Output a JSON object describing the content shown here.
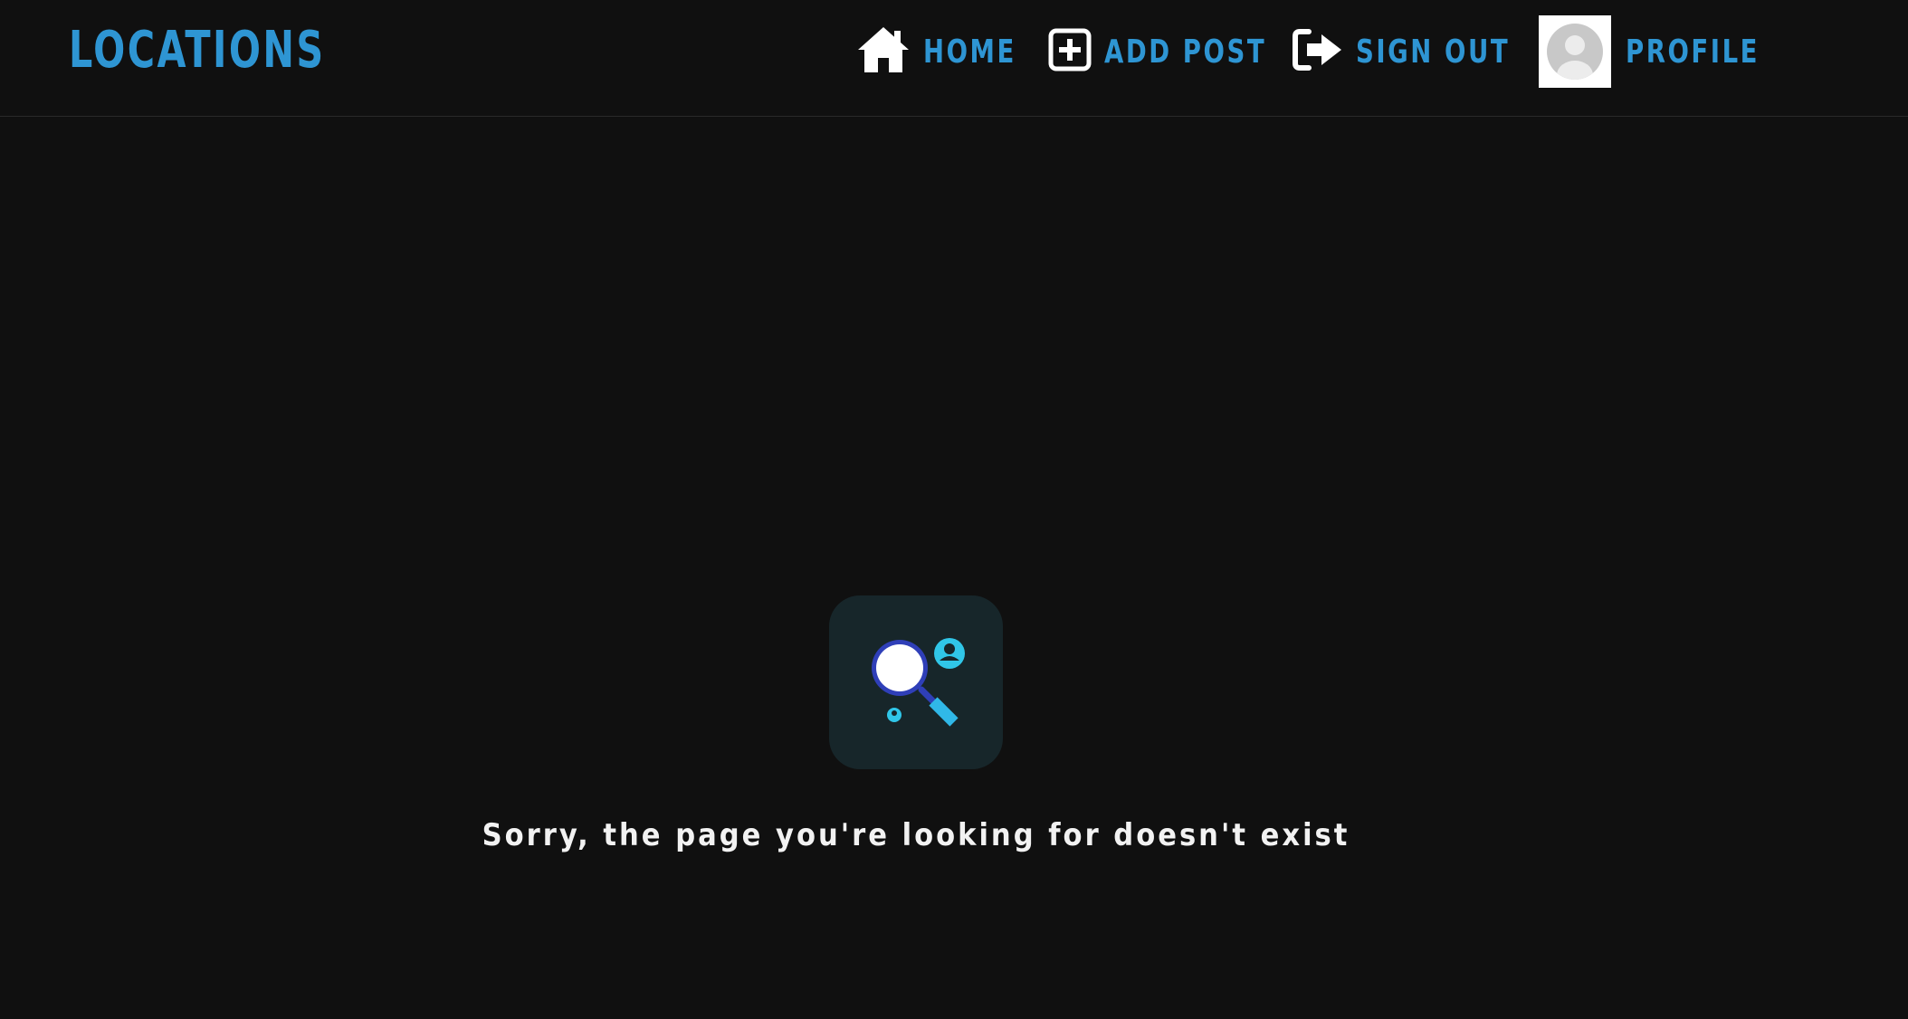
{
  "app": {
    "brand": "LOCATIONS"
  },
  "nav": {
    "home": {
      "label": "HOME",
      "icon": "house-icon"
    },
    "add_post": {
      "label": "ADD POST",
      "icon": "plus-square-icon"
    },
    "sign_out": {
      "label": "SIGN OUT",
      "icon": "sign-out-icon"
    },
    "profile": {
      "label": "PROFILE",
      "icon": "avatar-placeholder"
    }
  },
  "not_found": {
    "illustration": "magnifying-glass-search-icon",
    "message": "Sorry, the page you're looking for doesn't exist"
  },
  "colors": {
    "background": "#101010",
    "accent": "#2e95d3",
    "message_text": "#f2f2f2",
    "illustration_bg": "#17262a",
    "illustration_glass": "#2f3fb8",
    "illustration_handle": "#30b8e8",
    "illustration_dots": "#30c6e8"
  }
}
